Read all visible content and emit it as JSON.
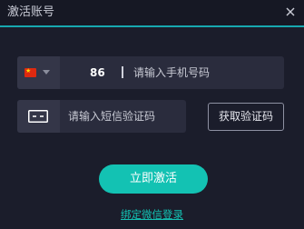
{
  "window": {
    "title": "激活账号"
  },
  "phone": {
    "country_flag": "china-flag-icon",
    "country_code": "86",
    "placeholder": "请输入手机号码",
    "value": ""
  },
  "sms": {
    "icon": "sms-code-icon",
    "placeholder": "请输入短信验证码",
    "value": "",
    "get_code_label": "获取验证码"
  },
  "actions": {
    "activate_label": "立即激活",
    "wechat_login_label": "绑定微信登录"
  },
  "colors": {
    "background": "#1b1d2b",
    "titlebar": "#161824",
    "accent": "#13c2b3",
    "input_bg": "#2a2c3d",
    "input_icon_bg": "#343648"
  }
}
